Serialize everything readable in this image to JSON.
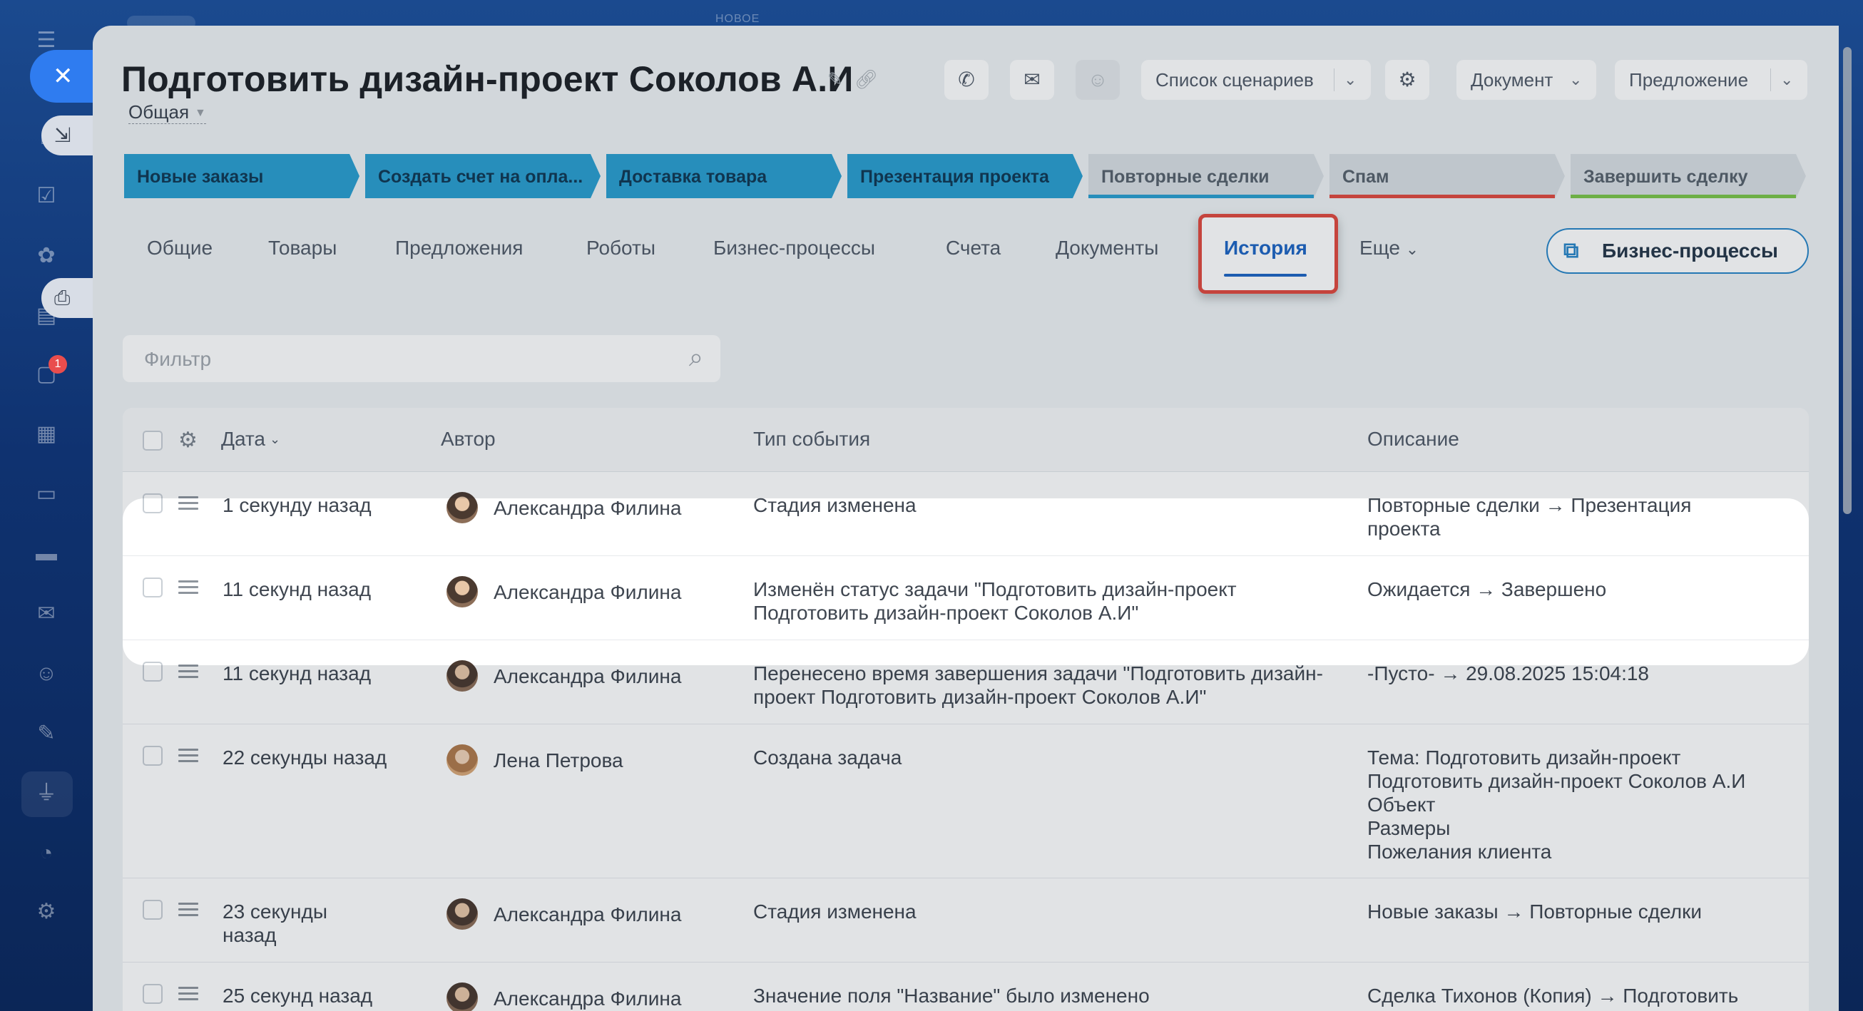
{
  "background": {
    "top_label": "НОВОЕ",
    "rail_icons": [
      "menu-icon",
      "user-home-icon",
      "tasks-icon",
      "puzzle-icon",
      "document-icon",
      "chat-icon",
      "calendar-icon",
      "file-icon",
      "card-icon",
      "mail-icon",
      "contacts-icon",
      "pen-icon",
      "funnel-icon",
      "clock-icon",
      "settings-icon"
    ],
    "chat_badge": "1"
  },
  "side_tools": {
    "close_icon": "close-icon",
    "collapse_icon": "collapse-icon",
    "print_icon": "printer-icon"
  },
  "header": {
    "title": "Подготовить дизайн-проект Соколов А.И",
    "category": "Общая",
    "buttons": {
      "phone_icon": "phone-icon",
      "mail_icon": "mail-icon",
      "chat_icon": "chat-icon",
      "scenarios_label": "Список сценариев",
      "settings_icon": "gear-icon",
      "document_label": "Документ",
      "offer_label": "Предложение"
    }
  },
  "stages": [
    {
      "label": "Новые заказы",
      "active": true
    },
    {
      "label": "Создать счет на опла...",
      "active": true
    },
    {
      "label": "Доставка товара",
      "active": true
    },
    {
      "label": "Презентация проекта",
      "active": true
    },
    {
      "label": "Повторные сделки",
      "active": false,
      "bar_color": "#2c9fd0"
    },
    {
      "label": "Спам",
      "active": false,
      "bar_color": "#e04a40"
    },
    {
      "label": "Завершить сделку",
      "active": false,
      "bar_color": "#7bc44a"
    }
  ],
  "tabs": [
    {
      "label": "Общие"
    },
    {
      "label": "Товары"
    },
    {
      "label": "Предложения"
    },
    {
      "label": "Роботы"
    },
    {
      "label": "Бизнес-процессы"
    },
    {
      "label": "Счета"
    },
    {
      "label": "Документы"
    },
    {
      "label": "История",
      "active": true
    },
    {
      "label": "Еще"
    }
  ],
  "bp_button_label": "Бизнес-процессы",
  "filter": {
    "placeholder": "Фильтр"
  },
  "table": {
    "columns": [
      "Дата",
      "Автор",
      "Тип события",
      "Описание"
    ],
    "rows": [
      {
        "date": "1 секунду назад",
        "author": "Александра Филина",
        "event": "Стадия изменена",
        "desc": "Повторные сделки → Презентация проекта"
      },
      {
        "date": "11 секунд назад",
        "author": "Александра Филина",
        "event": "Изменён статус задачи \"Подготовить дизайн-проект Подготовить дизайн-проект Соколов А.И\"",
        "desc": "Ожидается → Завершено"
      },
      {
        "date": "11 секунд назад",
        "author": "Александра Филина",
        "event": "Перенесено время завершения задачи \"Подготовить дизайн-проект Подготовить дизайн-проект Соколов А.И\"",
        "desc": "-Пусто- → 29.08.2025 15:04:18"
      },
      {
        "date": "22 секунды назад",
        "author": "Лена Петрова",
        "event": "Создана задача",
        "desc": "Тема: Подготовить дизайн-проект Подготовить дизайн-проект Соколов А.И\nОбъект\nРазмеры\nПожелания клиента"
      },
      {
        "date": "23 секунды назад",
        "author": "Александра Филина",
        "event": "Стадия изменена",
        "desc": "Новые заказы → Повторные сделки"
      },
      {
        "date": "25 секунд назад",
        "author": "Александра Филина",
        "event": "Значение поля \"Название\" было изменено",
        "desc": "Сделка Тихонов (Копия) → Подготовить"
      }
    ]
  },
  "colors": {
    "accent": "#1f66c3",
    "stage_active": "#2c9fd0",
    "highlight": "#e04a40"
  }
}
